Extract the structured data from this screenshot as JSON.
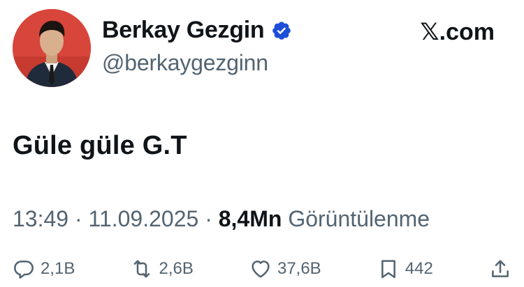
{
  "user": {
    "name": "Berkay Gezgin",
    "handle": "@berkaygezginn",
    "verified_color": "#1d4ed8"
  },
  "brand": {
    "label": "𝕏.com"
  },
  "tweet": {
    "text": "Güle güle G.T"
  },
  "meta": {
    "time": "13:49",
    "date": "11.09.2025",
    "views_count": "8,4Mn",
    "views_label": "Görüntülenme",
    "separator": " · "
  },
  "actions": {
    "replies": "2,1B",
    "reposts": "2,6B",
    "likes": "37,6B",
    "bookmarks": "442"
  }
}
